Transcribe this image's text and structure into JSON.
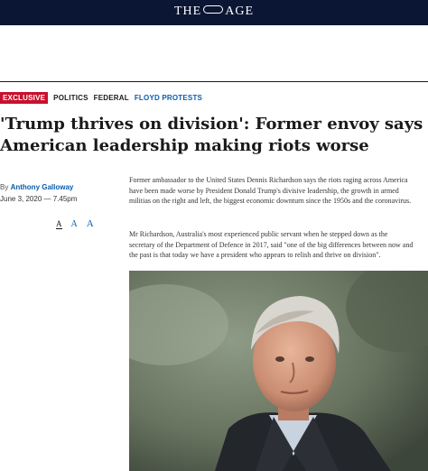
{
  "masthead": {
    "left": "THE",
    "right": "AGE"
  },
  "tags": {
    "exclusive": "EXCLUSIVE",
    "items": [
      "POLITICS",
      "FEDERAL",
      "FLOYD PROTESTS"
    ]
  },
  "article": {
    "headline": "'Trump thrives on division': Former envoy says American leadership making riots worse",
    "byline_prefix": "By",
    "author": "Anthony Galloway",
    "date": "June 3, 2020 — 7.45pm",
    "font_controls": [
      "A",
      "A",
      "A"
    ],
    "paragraphs": [
      [
        "Former ambassador to the United States Dennis Richardson says the riots raging across America",
        "have been made worse by President Donald Trump's divisive leadership, the growth in armed",
        "militias on the right and left, the biggest economic downturn since the 1950s and the coronavirus."
      ],
      [
        "Mr Richardson, Australia's most experienced public servant when he stepped down as the",
        "secretary of the Department of Defence in 2017, said \"one of the big differences between now and",
        "the past is that today we have a president who appears to relish and thrive on division\"."
      ]
    ]
  },
  "colors": {
    "brand_navy": "#0a1633",
    "exclusive_red": "#c8102e",
    "link_blue": "#0a5ca8"
  }
}
